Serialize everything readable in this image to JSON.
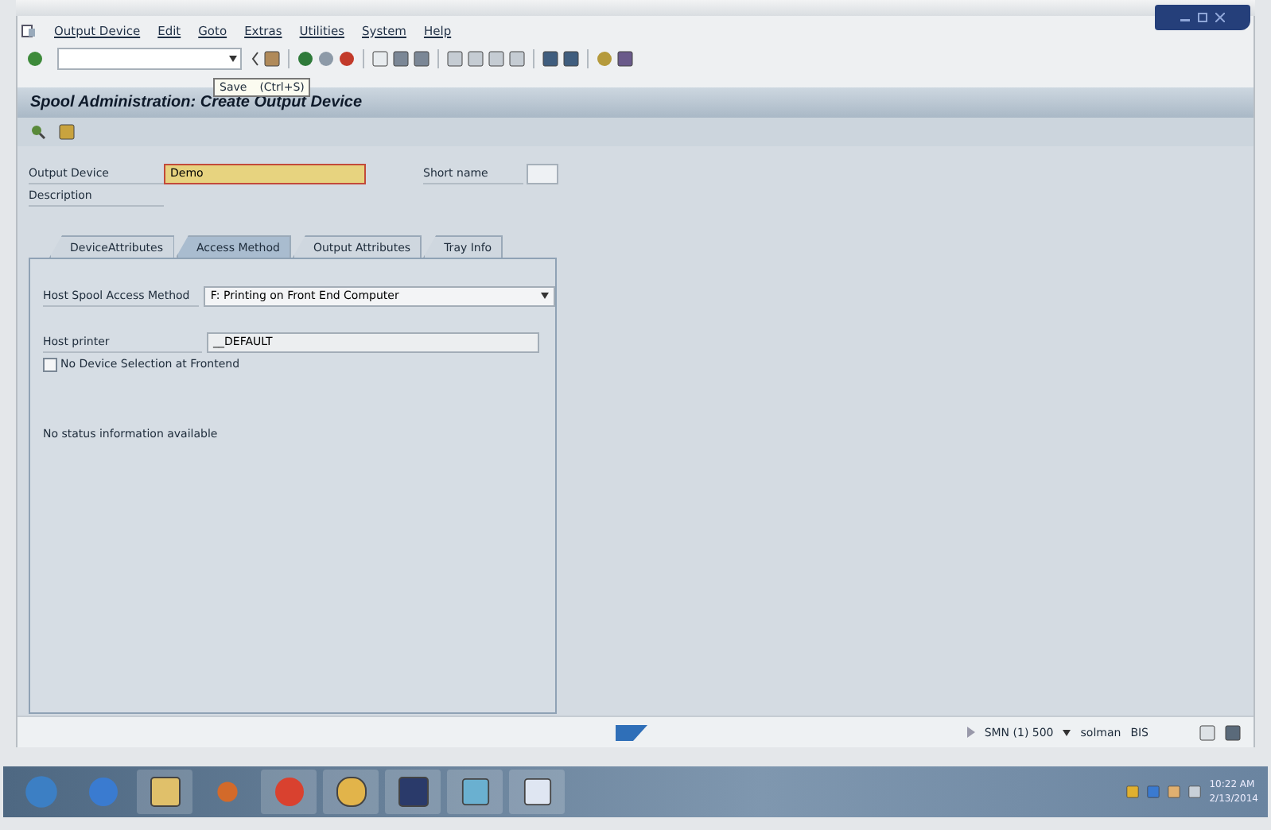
{
  "menu": [
    "Output Device",
    "Edit",
    "Goto",
    "Extras",
    "Utilities",
    "System",
    "Help"
  ],
  "tooltip": {
    "label": "Save",
    "shortcut": "(Ctrl+S)"
  },
  "title": "Spool Administration: Create Output Device",
  "output_device": {
    "label": "Output Device",
    "value": "Demo"
  },
  "short_name": {
    "label": "Short name"
  },
  "description": {
    "label": "Description"
  },
  "tabs": [
    {
      "label": "DeviceAttributes",
      "selected": false
    },
    {
      "label": "Access Method",
      "selected": true
    },
    {
      "label": "Output Attributes",
      "selected": false
    },
    {
      "label": "Tray Info",
      "selected": false
    }
  ],
  "access_method": {
    "label": "Host Spool Access Method",
    "value": "F: Printing on Front End Computer"
  },
  "host_printer": {
    "label": "Host printer",
    "value": "__DEFAULT"
  },
  "no_device_selection": {
    "label": "No Device Selection at Frontend",
    "checked": false
  },
  "status_text": "No status information available",
  "status_bar": {
    "system": "SMN (1) 500",
    "user": "solman",
    "server": "BIS"
  },
  "clock": {
    "time": "10:22 AM",
    "date": "2/13/2014"
  }
}
